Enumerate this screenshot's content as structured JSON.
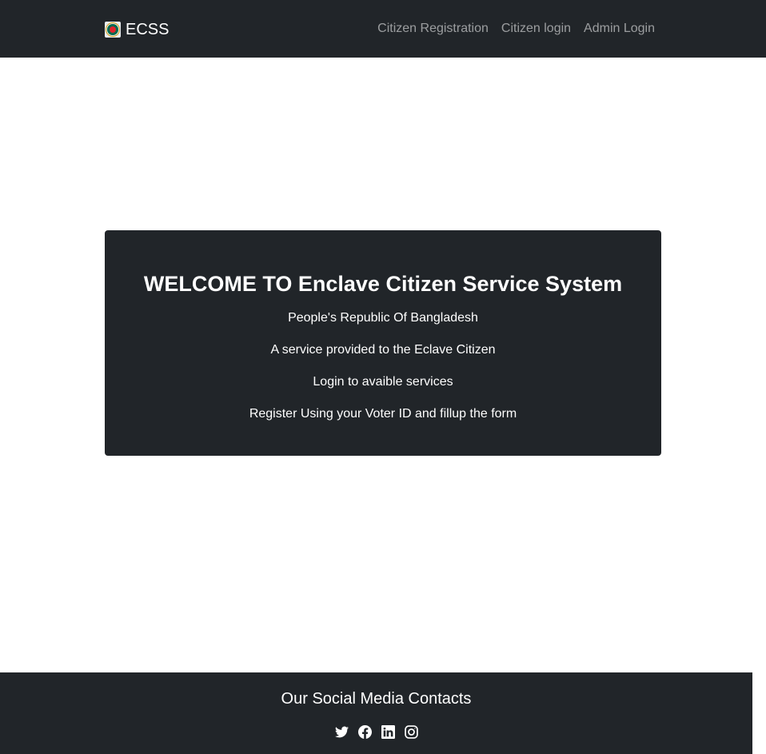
{
  "navbar": {
    "brand": "ECSS",
    "links": [
      {
        "label": "Citizen Registration"
      },
      {
        "label": "Citizen login"
      },
      {
        "label": "Admin Login"
      }
    ]
  },
  "hero": {
    "title": "WELCOME TO Enclave Citizen Service System",
    "lines": [
      "People's Republic Of Bangladesh",
      "A service provided to the Eclave Citizen",
      "Login to avaible services",
      "Register Using your Voter ID and fillup the form"
    ]
  },
  "footer": {
    "title": "Our Social Media Contacts",
    "icons": [
      "twitter-icon",
      "facebook-icon",
      "linkedin-icon",
      "instagram-icon"
    ]
  },
  "colors": {
    "navbar_bg": "#212529",
    "nav_link": "rgba(255,255,255,0.55)",
    "text_light": "#ffffff"
  }
}
